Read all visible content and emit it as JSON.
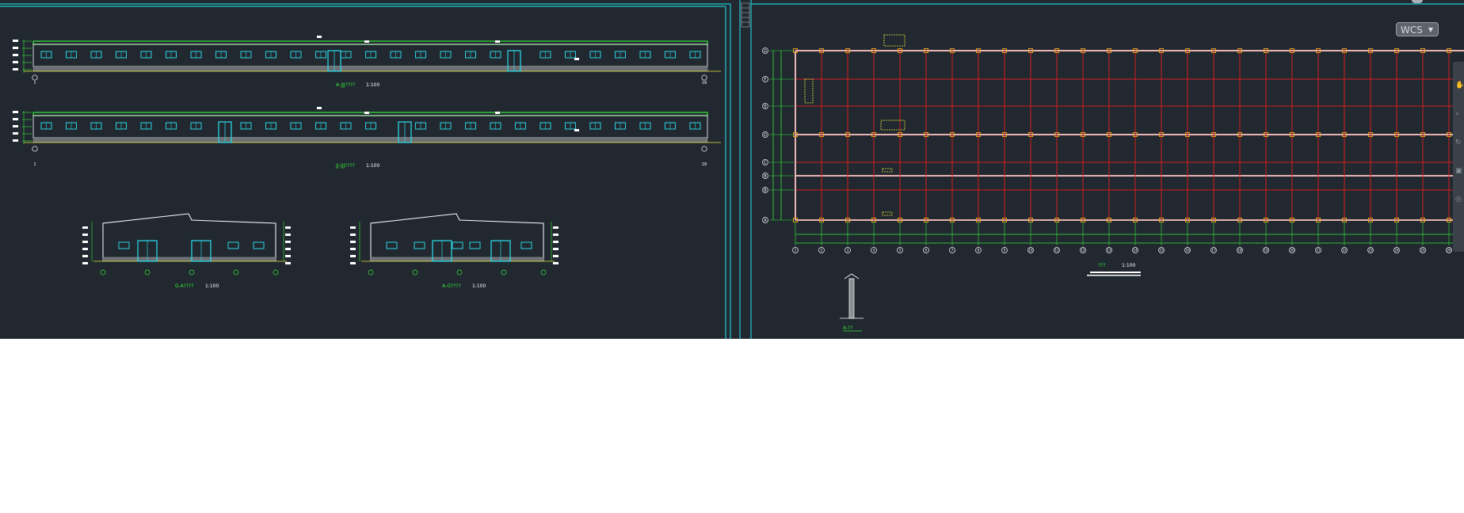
{
  "left_sheet": {
    "views": [
      {
        "title": "A-JJJ????",
        "scale": "1:100"
      },
      {
        "title": "JJ-JJJ????",
        "scale": "1:100"
      },
      {
        "title": "G-A????",
        "scale": "1:100"
      },
      {
        "title": "A-G????",
        "scale": "1:100"
      }
    ],
    "axis_start": "1",
    "axis_end": "18"
  },
  "right_sheet": {
    "plan_title": "???",
    "plan_scale": "1:100",
    "detail_title": "A-??",
    "row_labels": [
      "G",
      "F",
      "E",
      "D",
      "C",
      "B",
      "B",
      "A"
    ],
    "col_labels": [
      "1",
      "2",
      "3",
      "4",
      "5",
      "6",
      "7",
      "8",
      "9",
      "10",
      "11",
      "12",
      "13",
      "14",
      "15",
      "16",
      "17",
      "18",
      "19",
      "20",
      "21",
      "22",
      "23",
      "24",
      "25",
      "26",
      "27"
    ]
  },
  "viewport": {
    "wcs_label": "WCS"
  },
  "colors": {
    "background": "#212830",
    "frame": "#1fc9d1",
    "grid": "#d81e1e",
    "outline": "#36e83a",
    "window": "#2ad3e0",
    "annotation": "#e8e63c"
  }
}
